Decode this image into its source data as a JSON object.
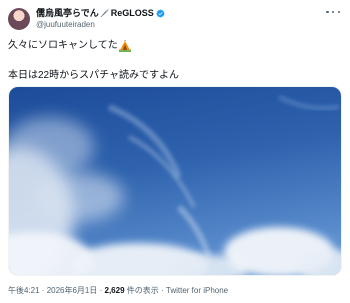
{
  "author": {
    "display_name_part1": "儒烏風亭らでん",
    "display_name_part2": "ReGLOSS",
    "handle": "@juufuuteiraden"
  },
  "post": {
    "line1": "久々にソロキャンしてた",
    "line2": "本日は22時からスパチャ読みですよん"
  },
  "footer": {
    "time": "午後4:21",
    "separator1": " · ",
    "date": "2026年6月1日",
    "separator2": " · ",
    "views_count": "2,629",
    "views_label": " 件の表示",
    "separator3": " · ",
    "client": "Twitter for iPhone"
  },
  "icons": {
    "more": "more-options-icon",
    "verified": "verified-badge-icon",
    "name_emoji": "feather-emoji",
    "tent": "camping-tent-emoji"
  },
  "colors": {
    "verified": "#1d9bf0",
    "sky_top": "#1f4f9c",
    "sky_bottom": "#5b8fd0"
  }
}
